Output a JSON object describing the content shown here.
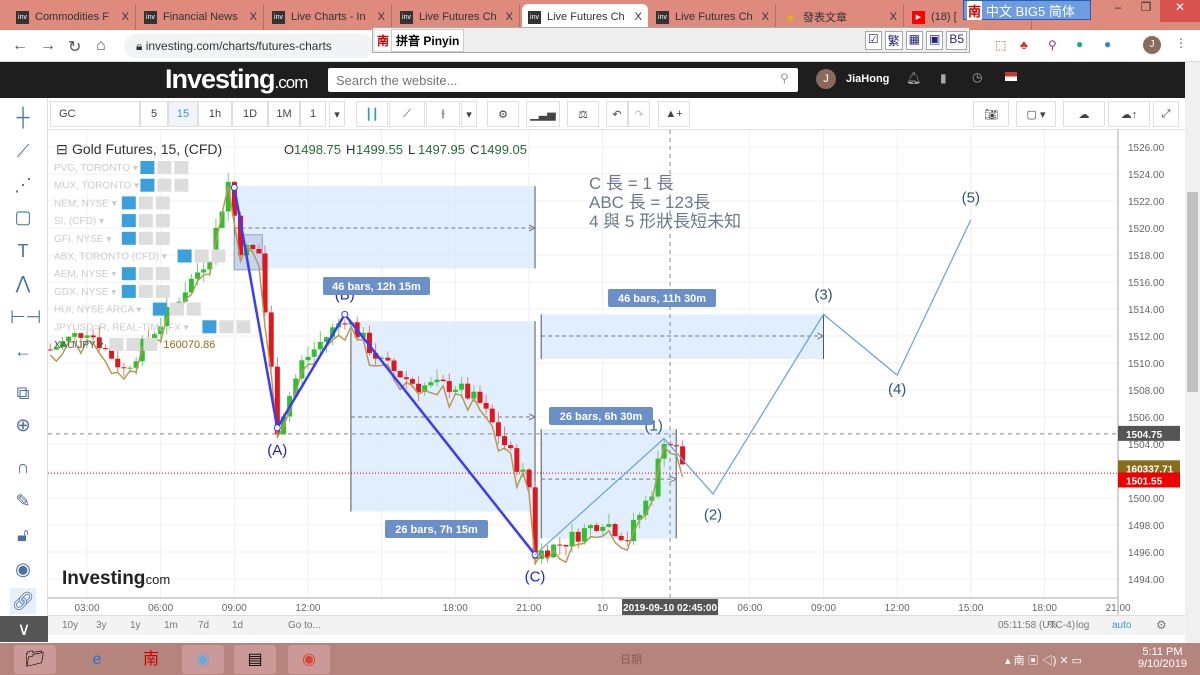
{
  "browser": {
    "tabs": [
      {
        "label": "Commodities F",
        "active": false,
        "icon": "inv"
      },
      {
        "label": "Financial News",
        "active": false,
        "icon": "inv"
      },
      {
        "label": "Live Charts - In",
        "active": false,
        "icon": "inv"
      },
      {
        "label": "Live Futures Ch",
        "active": false,
        "icon": "inv"
      },
      {
        "label": "Live Futures Ch",
        "active": true,
        "icon": "inv"
      },
      {
        "label": "Live Futures Ch",
        "active": false,
        "icon": "inv"
      },
      {
        "label": "發表文章",
        "active": false,
        "icon": "bulb"
      },
      {
        "label": "(18) [",
        "active": false,
        "icon": "youtube"
      }
    ],
    "close_glyph": "X",
    "url": "investing.com/charts/futures-charts",
    "ime_bar": {
      "badge": "南",
      "label": "中文 BIG5 简体"
    },
    "pinyin_bar": {
      "badge": "南",
      "label": "拼音 Pinyin",
      "buttons": [
        "☑",
        "繁",
        "▦",
        "▣",
        "B5"
      ]
    }
  },
  "site": {
    "logo": "Investing",
    "logo_suffix": ".com",
    "search_placeholder": "Search the website...",
    "user": "JiaHong",
    "avatar_letter": "J"
  },
  "toolbar": {
    "symbol": "GC",
    "intervals": [
      "5",
      "15",
      "1h",
      "1D",
      "1M",
      "1"
    ],
    "active_interval": "15"
  },
  "legend": {
    "title": "Gold Futures, 15, (CFD)",
    "open_label": "O",
    "open": "1498.75",
    "high_label": "H",
    "high": "1499.55",
    "low_label": "L",
    "low": "1497.95",
    "close_label": "C",
    "close": "1499.05",
    "overlays": [
      "PVG, TORONTO",
      "MUX, TORONTO",
      "NEM, NYSE",
      "SI, (CFD)",
      "GFI, NYSE",
      "ABX, TORONTO (CFD)",
      "AEM, NYSE",
      "GDX, NYSE",
      "HUI, NYSE ARCA",
      "JPYUSD=R, REAL-TIME FX",
      "XAU/JPY"
    ],
    "xau_jpy_value": "160070.86"
  },
  "annotations": {
    "note_lines": [
      "C 長 = 1 長",
      "ABC 長 = 123長",
      "4 與 5 形狀長短未知"
    ],
    "waves": [
      "(A)",
      "(B)",
      "(C)",
      "(1)",
      "(2)",
      "(3)",
      "(4)",
      "(5)"
    ],
    "ranges": [
      "46 bars, 12h 15m",
      "26 bars, 7h 15m",
      "46 bars, 11h 30m",
      "26 bars, 6h 30m"
    ]
  },
  "price_axis": {
    "ticks": [
      "1526.00",
      "1524.00",
      "1522.00",
      "1520.00",
      "1518.00",
      "1516.00",
      "1514.00",
      "1512.00",
      "1510.00",
      "1508.00",
      "1506.00",
      "1504.00",
      "1502.00",
      "1500.00",
      "1498.00",
      "1496.00",
      "1494.00"
    ],
    "crosshair_price": "1504.75",
    "xau_jpy_last": "160337.71",
    "last_price": "1501.55"
  },
  "time_axis": {
    "ticks": [
      "03:00",
      "06:00",
      "09:00",
      "12:00",
      "18:00",
      "21:00",
      "10",
      "06:00",
      "09:00",
      "12:00",
      "15:00",
      "18:00",
      "21:00"
    ],
    "crosshair_time": "2019-09-10 02:45:00"
  },
  "bottom": {
    "ranges": [
      "10y",
      "3y",
      "1y",
      "1m",
      "7d",
      "1d"
    ],
    "goto": "Go to...",
    "clock": "05:11:58 (UTC-4)",
    "pct": "%",
    "log": "log",
    "auto": "auto"
  },
  "watermark": {
    "logo": "Investing",
    "suffix": ".com"
  },
  "colors": {
    "up": "#2fbf2f",
    "down": "#e0161b",
    "wave_abc": "#3a3aff",
    "wave_123": "#6fa6e0",
    "range_fill": "#dcebfd",
    "overlay": "#b59a5a"
  },
  "taskbar": {
    "center": "日期",
    "time": "5:11 PM",
    "date": "9/10/2019"
  },
  "price_path": [
    [
      "09 01:30",
      1511
    ],
    [
      "09 03:00",
      1512.5
    ],
    [
      "09 04:30",
      1509.5
    ],
    [
      "09 06:00",
      1513
    ],
    [
      "09 07:00",
      1515.5
    ],
    [
      "09 08:00",
      1518
    ],
    [
      "09 08:45",
      1523.4
    ],
    [
      "09 09:15",
      1518.5
    ],
    [
      "09 10:00",
      1518.2
    ],
    [
      "09 10:45",
      1505.2
    ],
    [
      "09 11:45",
      1510
    ],
    [
      "09 12:30",
      1511.5
    ],
    [
      "09 13:30",
      1513.4
    ],
    [
      "09 15:00",
      1510
    ],
    [
      "09 16:30",
      1508.3
    ],
    [
      "09 18:00",
      1508.3
    ],
    [
      "09 19:00",
      1507
    ],
    [
      "09 20:00",
      1504
    ],
    [
      "09 21:00",
      1501
    ],
    [
      "09 21:15",
      1495.8
    ],
    [
      "09 22:30",
      1496.8
    ],
    [
      "10 00:00",
      1498.4
    ],
    [
      "10 01:00",
      1497
    ],
    [
      "10 02:00",
      1500.5
    ],
    [
      "10 02:30",
      1504.5
    ],
    [
      "10 03:00",
      1503.6
    ],
    [
      "10 03:30",
      1501.6
    ]
  ]
}
